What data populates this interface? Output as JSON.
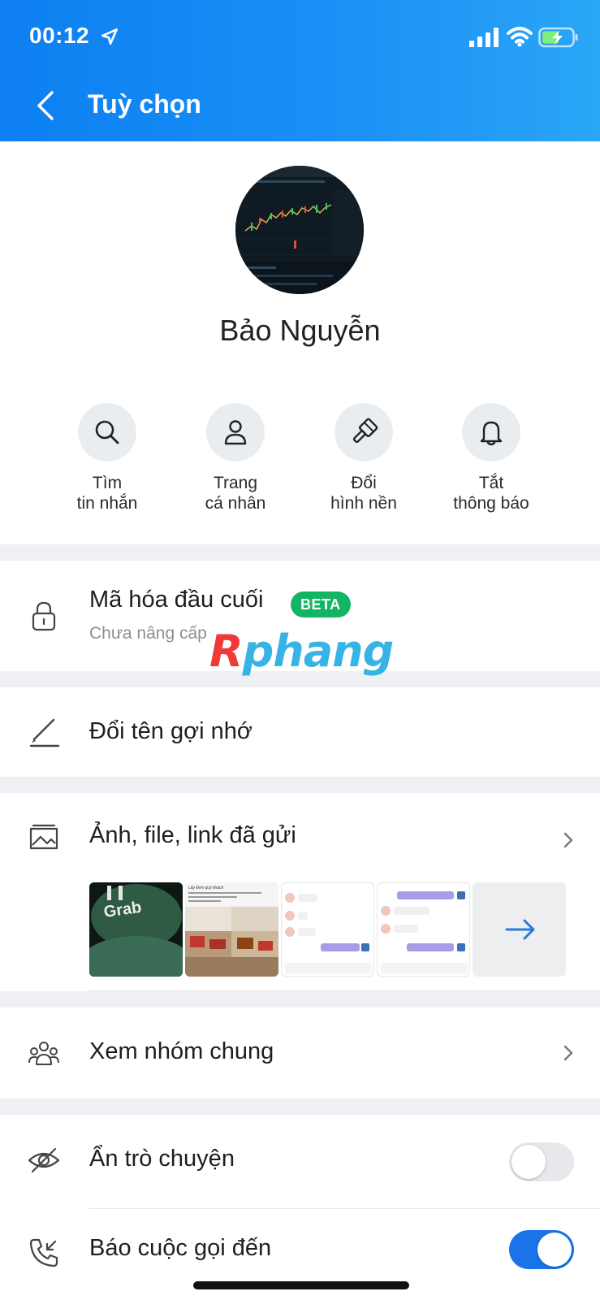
{
  "status_bar": {
    "time": "00:12"
  },
  "header": {
    "title": "Tuỳ chọn"
  },
  "profile": {
    "name": "Bảo Nguyễn"
  },
  "actions": [
    {
      "line1": "Tìm",
      "line2": "tin nhắn",
      "icon": "search-icon"
    },
    {
      "line1": "Trang",
      "line2": "cá nhân",
      "icon": "person-icon"
    },
    {
      "line1": "Đổi",
      "line2": "hình nền",
      "icon": "paintbrush-icon"
    },
    {
      "line1": "Tắt",
      "line2": "thông báo",
      "icon": "bell-icon"
    }
  ],
  "encryption": {
    "title": "Mã hóa đầu cuối",
    "badge": "BETA",
    "subtitle": "Chưa nâng cấp"
  },
  "rename": {
    "title": "Đổi tên gợi nhớ"
  },
  "media": {
    "title": "Ảnh, file, link đã gửi",
    "thumbs": [
      {
        "text": "Grab"
      },
      {
        "text": "Lấy Đơn quý khách"
      },
      {
        "text": "chat screenshot"
      },
      {
        "text": "chat screenshot"
      }
    ]
  },
  "groups": {
    "title": "Xem nhóm chung"
  },
  "hide_chat": {
    "title": "Ẩn trò chuyện",
    "enabled": false
  },
  "call_notify": {
    "title": "Báo cuộc gọi đến",
    "enabled": true
  },
  "watermark": {
    "first": "R",
    "rest": "phang"
  },
  "colors": {
    "header_start": "#0d7ff2",
    "header_end": "#2aa6f6",
    "beta_green": "#13b564",
    "toggle_on": "#1a73e8",
    "toggle_off": "#e6e8eb"
  }
}
